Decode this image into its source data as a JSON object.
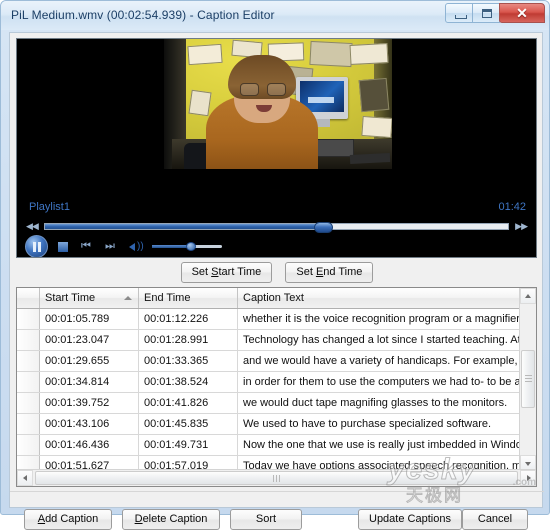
{
  "window": {
    "title": "PiL Medium.wmv (00:02:54.939) - Caption Editor",
    "controls": {
      "minimize": "Minimize",
      "maximize": "Maximize",
      "close": "✕"
    }
  },
  "player": {
    "playlist_label": "Playlist1",
    "duration": "01:42",
    "seek_percent": 60,
    "volume_percent": 55,
    "buttons": {
      "play_pause": "Pause",
      "stop": "Stop",
      "previous": "Previous",
      "next": "Next",
      "volume": "Volume",
      "rewind": "◀◀",
      "forward": "▶▶"
    }
  },
  "toolbar": {
    "set_start_time": "Set Start Time",
    "set_start_time_pre": "Set ",
    "set_start_time_accel": "S",
    "set_start_time_post": "tart Time",
    "set_end_time": "Set End Time",
    "set_end_time_pre": "Set ",
    "set_end_time_accel": "E",
    "set_end_time_post": "nd Time"
  },
  "grid": {
    "columns": [
      "",
      "Start Time",
      "End Time",
      "Caption Text"
    ],
    "sort_column": "Start Time",
    "sort_direction": "ascending",
    "rows": [
      {
        "start": "00:01:05.789",
        "end": "00:01:12.226",
        "text": "whether it is the voice recognition program or a magnifier or pos…"
      },
      {
        "start": "00:01:23.047",
        "end": "00:01:28.991",
        "text": "Technology has changed a lot since I started teaching. At first I …"
      },
      {
        "start": "00:01:29.655",
        "end": "00:01:33.365",
        "text": "and we would have a variety of handicaps. For example, my vis…"
      },
      {
        "start": "00:01:34.814",
        "end": "00:01:38.524",
        "text": "in order for them to use the computers we had to- to be able to …"
      },
      {
        "start": "00:01:39.752",
        "end": "00:01:41.826",
        "text": "we would duct tape magnifing glasses to the monitors."
      },
      {
        "start": "00:01:43.106",
        "end": "00:01:45.835",
        "text": "We used to have to purchase specialized software."
      },
      {
        "start": "00:01:46.436",
        "end": "00:01:49.731",
        "text": "Now the one that we use is really just imbedded in Windows."
      },
      {
        "start": "00:01:51.627",
        "end": "00:01:57.019",
        "text": "Today we have options associated speech recognition, magnifie…"
      }
    ]
  },
  "actions": {
    "add_caption": "Add Caption",
    "add_caption_accel": "A",
    "add_caption_post": "dd Caption",
    "delete_caption": "Delete Caption",
    "delete_caption_accel": "D",
    "delete_caption_post": "elete Caption",
    "sort": "Sort",
    "update_captions": "Update Captions",
    "cancel": "Cancel"
  },
  "watermark": {
    "main": "yesky",
    "domain": ".com",
    "chinese": "天极网"
  },
  "colors": {
    "accent_blue": "#2f63ad",
    "title_text": "#1c3f66",
    "close_red": "#bf3b33",
    "player_bg": "#000000",
    "playlist_text": "#3f76c4"
  }
}
